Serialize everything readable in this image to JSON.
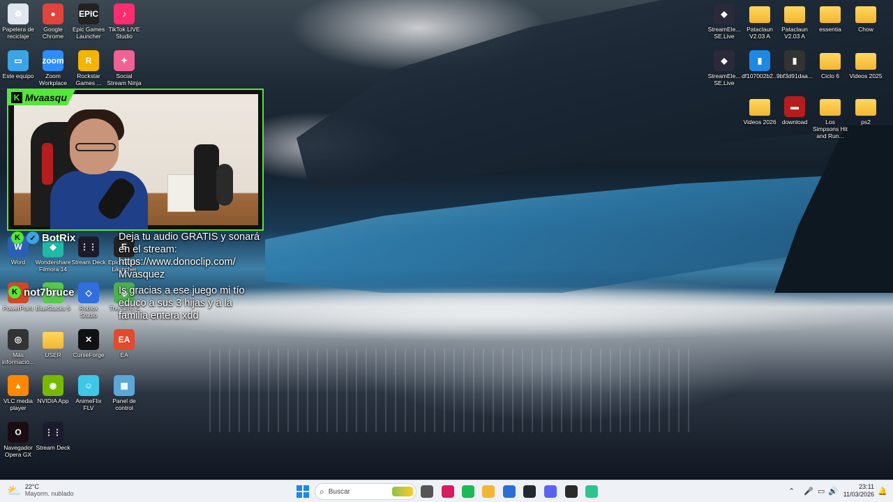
{
  "desktop_left": [
    {
      "label": "Papelera de reciclaje",
      "icon": "recycle-bin-icon",
      "color": "#dfe6ee",
      "glyph": "♻"
    },
    {
      "label": "Google Chrome",
      "icon": "chrome-icon",
      "color": "#e0443c",
      "glyph": "●"
    },
    {
      "label": "Epic Games Launcher",
      "icon": "epic-games-icon",
      "color": "#222222",
      "glyph": "EPIC"
    },
    {
      "label": "TikTok LIVE Studio",
      "icon": "tiktok-live-icon",
      "color": "#ff2d6f",
      "glyph": "♪"
    },
    {
      "label": "Este equipo",
      "icon": "computer-icon",
      "color": "#3aa4e6",
      "glyph": "▭"
    },
    {
      "label": "Zoom Workplace",
      "icon": "zoom-icon",
      "color": "#2d8cff",
      "glyph": "zoom"
    },
    {
      "label": "Rockstar Games ...",
      "icon": "rockstar-icon",
      "color": "#f4b400",
      "glyph": "R"
    },
    {
      "label": "Social Stream Ninja",
      "icon": "social-stream-icon",
      "color": "#f06292",
      "glyph": "✦"
    },
    {
      "label": "Word",
      "icon": "word-icon",
      "color": "#2b5fb4",
      "glyph": "W"
    },
    {
      "label": "Wondershare Filmora 14",
      "icon": "filmora-icon",
      "color": "#1fb9a6",
      "glyph": "◆"
    },
    {
      "label": "Stream Deck",
      "icon": "stream-deck-icon",
      "color": "#1b1b2e",
      "glyph": "⋮⋮"
    },
    {
      "label": "Epic Games Launcher",
      "icon": "epic-games-icon",
      "color": "#222222",
      "glyph": "E"
    },
    {
      "label": "PowerPoint",
      "icon": "powerpoint-icon",
      "color": "#d24726",
      "glyph": "P"
    },
    {
      "label": "BlueStacks 5",
      "icon": "bluestacks-icon",
      "color": "#57c84d",
      "glyph": "◈"
    },
    {
      "label": "Roblox Studio",
      "icon": "roblox-studio-icon",
      "color": "#2f6fe0",
      "glyph": "◇"
    },
    {
      "label": "The Sims 4",
      "icon": "sims-icon",
      "color": "#4caf50",
      "glyph": "◆"
    },
    {
      "label": "Más informació...",
      "icon": "info-icon",
      "color": "#333333",
      "glyph": "◎"
    },
    {
      "label": "USER",
      "icon": "folder-icon",
      "color": "#f2c14e",
      "glyph": ""
    },
    {
      "label": "CurseForge",
      "icon": "curseforge-icon",
      "color": "#111111",
      "glyph": "✕"
    },
    {
      "label": "EA",
      "icon": "ea-icon",
      "color": "#e24a2b",
      "glyph": "EA"
    },
    {
      "label": "VLC media player",
      "icon": "vlc-icon",
      "color": "#ff8800",
      "glyph": "▲"
    },
    {
      "label": "NVIDIA App",
      "icon": "nvidia-icon",
      "color": "#76b900",
      "glyph": "◉"
    },
    {
      "label": "AnimeFlix FLV",
      "icon": "animeflix-icon",
      "color": "#3fc7e8",
      "glyph": "☺"
    },
    {
      "label": "Panel de control",
      "icon": "control-panel-icon",
      "color": "#5aa7d8",
      "glyph": "▦"
    },
    {
      "label": "Navegador Opera GX",
      "icon": "opera-gx-icon",
      "color": "#1a0d12",
      "glyph": "O"
    },
    {
      "label": "Stream Deck",
      "icon": "stream-deck-icon",
      "color": "#1b1b2e",
      "glyph": "⋮⋮"
    }
  ],
  "desktop_right": [
    {
      "label": "StreamEle... SE.Live",
      "icon": "streamelements-icon",
      "color": "#2a2a3a",
      "glyph": "◆"
    },
    {
      "label": "Pataclaun V2.03 A",
      "icon": "folder-icon",
      "color": "#f2c14e",
      "glyph": ""
    },
    {
      "label": "Pataclaun V2.03 A",
      "icon": "folder-icon",
      "color": "#f2c14e",
      "glyph": ""
    },
    {
      "label": "essentia",
      "icon": "folder-icon",
      "color": "#f2c14e",
      "glyph": ""
    },
    {
      "label": "Chow",
      "icon": "folder-icon",
      "color": "#f2c14e",
      "glyph": ""
    },
    {
      "label": "StreamEle... SE.Live",
      "icon": "streamelements-icon",
      "color": "#2a2a3a",
      "glyph": "◆"
    },
    {
      "label": "df107002b2...",
      "icon": "image-file-icon",
      "color": "#1e88e5",
      "glyph": "▮"
    },
    {
      "label": "9bf3d91daa...",
      "icon": "image-file-icon",
      "color": "#333333",
      "glyph": "▮"
    },
    {
      "label": "Ciclo 6",
      "icon": "folder-icon",
      "color": "#f2c14e",
      "glyph": ""
    },
    {
      "label": "Videos 2025",
      "icon": "folder-icon",
      "color": "#f2c14e",
      "glyph": ""
    },
    {
      "label": "Videos 2026",
      "icon": "folder-icon",
      "color": "#f2c14e",
      "glyph": ""
    },
    {
      "label": "download",
      "icon": "image-file-icon",
      "color": "#b71c1c",
      "glyph": "▬"
    },
    {
      "label": "Los Simpsons Hit and Run...",
      "icon": "folder-icon",
      "color": "#f2c14e",
      "glyph": ""
    },
    {
      "label": "ps2",
      "icon": "folder-icon",
      "color": "#f2c14e",
      "glyph": ""
    }
  ],
  "webcam": {
    "username": "Mvaasqu",
    "badge": "K"
  },
  "chat": {
    "users": [
      {
        "name": "BotRix",
        "badge": "K"
      },
      {
        "name": "not7bruce",
        "badge": "K"
      }
    ],
    "messages": [
      {
        "text": "Deja tu audio GRATIS y sonará en el stream: https://www.donoclip.com/ Mvasquez"
      },
      {
        "text": "Is gracias a ese juego mi tío educo a sus 3 hijas y a la familia entera xdd"
      }
    ]
  },
  "taskbar": {
    "weather_temp": "22°C",
    "weather_desc": "Mayorm. nublado",
    "search_placeholder": "Buscar",
    "time": "23:11",
    "date": "11/03/2026",
    "apps": [
      {
        "icon": "file-explorer-taskview-icon",
        "color": "#555555"
      },
      {
        "icon": "opera-icon",
        "color": "#d81b60"
      },
      {
        "icon": "spotify-icon",
        "color": "#1db954"
      },
      {
        "icon": "folder-icon",
        "color": "#f2b632"
      },
      {
        "icon": "microsoft-store-icon",
        "color": "#2b6fd6"
      },
      {
        "icon": "terminal-icon",
        "color": "#1f2a33"
      },
      {
        "icon": "discord-icon",
        "color": "#5865f2"
      },
      {
        "icon": "obs-icon",
        "color": "#2b2b2b"
      },
      {
        "icon": "streamlabs-icon",
        "color": "#30c48d"
      }
    ]
  }
}
